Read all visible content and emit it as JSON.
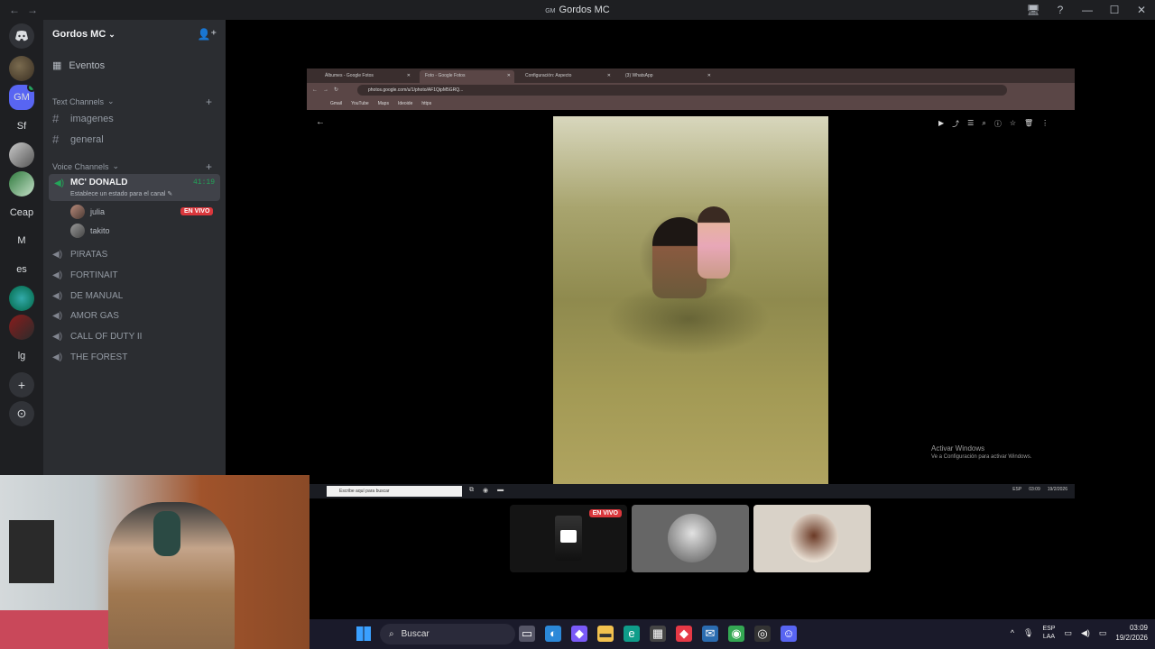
{
  "window": {
    "title": "Gordos MC",
    "badge": "GM",
    "nav": [
      "←",
      "→"
    ],
    "controls": [
      "🖥",
      "?",
      "—",
      "☐",
      "✕"
    ]
  },
  "rail": {
    "servers": [
      {
        "label": "",
        "kind": "discord-home"
      },
      {
        "label": "",
        "kind": "pic1"
      },
      {
        "label": "GM",
        "kind": "gm"
      },
      {
        "label": "Sf",
        "kind": "text"
      },
      {
        "label": "",
        "kind": "pic2"
      },
      {
        "label": "",
        "kind": "pic3"
      },
      {
        "label": "Ceap",
        "kind": "text"
      },
      {
        "label": "M",
        "kind": "text"
      },
      {
        "label": "es",
        "kind": "text"
      },
      {
        "label": "",
        "kind": "pic4"
      },
      {
        "label": "",
        "kind": "pic5"
      },
      {
        "label": "lg",
        "kind": "text"
      },
      {
        "label": "+",
        "kind": "add"
      },
      {
        "label": "⊙",
        "kind": "discover"
      }
    ]
  },
  "sidebar": {
    "server_name": "Gordos MC",
    "events_label": "Eventos",
    "text_category": "Text Channels",
    "text_channels": [
      "imagenes",
      "general"
    ],
    "voice_category": "Voice Channels",
    "active_voice": {
      "name": "MC' DONALD",
      "time": "41:19",
      "status": "Establece un estado para el canal"
    },
    "users": [
      {
        "name": "julia",
        "live": "EN VIVO"
      },
      {
        "name": "takito"
      }
    ],
    "voice_channels": [
      "PIRATAS",
      "FORTINAIT",
      "DE MANUAL",
      "AMOR GAS",
      "CALL OF DUTY II",
      "THE FOREST"
    ]
  },
  "browser": {
    "tabs": [
      {
        "label": "Álbumes - Google Fotos",
        "active": false
      },
      {
        "label": "Foto - Google Fotos",
        "active": true
      },
      {
        "label": "Configuración: Aspecto",
        "active": false
      },
      {
        "label": "(3) WhatsApp",
        "active": false
      }
    ],
    "url": "photos.google.com/u/1/photo/AF1QipM5GRQ...",
    "bookmarks": [
      "Gmail",
      "YouTube",
      "Maps",
      "Ideoide",
      "https"
    ],
    "activate_title": "Activar Windows",
    "activate_sub": "Ve a Configuración para activar Windows.",
    "inner_search": "Escribe aquí para buscar",
    "inner_lang": "ESP",
    "inner_time": "03:09",
    "inner_date": "19/2/2026"
  },
  "tiles": {
    "live_label": "EN VIVO"
  },
  "taskbar": {
    "search_label": "Buscar",
    "lang_line1": "ESP",
    "lang_line2": "LAA",
    "time": "03:09",
    "date": "19/2/2026"
  }
}
